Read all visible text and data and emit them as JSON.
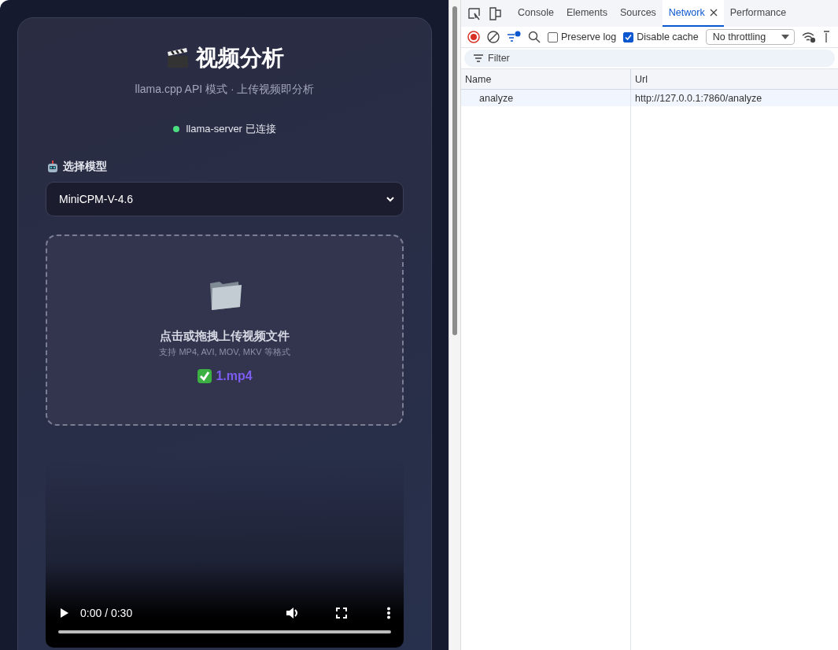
{
  "app": {
    "title": "视频分析",
    "subtitle": "llama.cpp API 模式 · 上传视频即分析",
    "status": {
      "text": "llama-server 已连接",
      "connected": true
    },
    "model_label": "选择模型",
    "model_select": {
      "value": "MiniCPM-V-4.6"
    },
    "upload": {
      "prompt": "点击或拖拽上传视频文件",
      "hint": "支持 MP4, AVI, MOV, MKV 等格式",
      "file": "1.mp4"
    },
    "video": {
      "time": "0:00 / 0:30"
    }
  },
  "devtools": {
    "tabs": [
      {
        "label": "Console",
        "selected": false
      },
      {
        "label": "Elements",
        "selected": false
      },
      {
        "label": "Sources",
        "selected": false
      },
      {
        "label": "Network",
        "selected": true
      },
      {
        "label": "Performance",
        "selected": false
      }
    ],
    "preserve_log": {
      "label": "Preserve log",
      "checked": false
    },
    "disable_cache": {
      "label": "Disable cache",
      "checked": true
    },
    "throttling": "No throttling",
    "filter": {
      "placeholder": "Filter"
    },
    "columns": [
      "Name",
      "Url"
    ],
    "rows": [
      {
        "name": "analyze",
        "url": "http://127.0.0.1:7860/analyze"
      }
    ]
  }
}
